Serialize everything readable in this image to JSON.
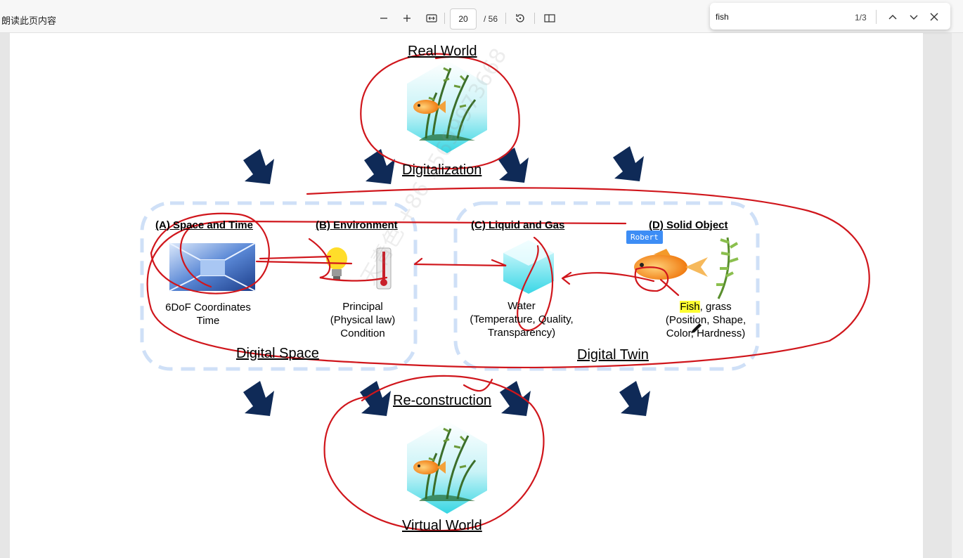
{
  "toolbar": {
    "read_aloud": "朗读此页内容",
    "current_page": "20",
    "total_pages": "/ 56",
    "zoom_out_icon": "minus-icon",
    "zoom_in_icon": "plus-icon",
    "fit_icon": "fit-width-icon",
    "rotate_icon": "rotate-icon",
    "layout_icon": "two-page-icon"
  },
  "find": {
    "query": "fish",
    "count": "1/3",
    "prev_icon": "chevron-up-icon",
    "next_icon": "chevron-down-icon",
    "close_icon": "close-icon"
  },
  "figure": {
    "real_world": "Real World",
    "digitalization": "Digitalization",
    "a_title": "(A) Space and Time",
    "a_desc1": "6DoF Coordinates",
    "a_desc2": "Time",
    "b_title": "(B) Environment",
    "b_desc1": "Principal",
    "b_desc2": "(Physical law)",
    "b_desc3": "Condition",
    "c_title": "(C) Liquid and Gas",
    "c_desc1": "Water",
    "c_desc2": "(Temperature, Quality,",
    "c_desc3": "Transparency)",
    "d_title": "(D) Solid Object",
    "d_desc_fish": "Fish",
    "d_desc_rest": ", grass",
    "d_desc2": "(Position, Shape,",
    "d_desc3": "Color, Hardness)",
    "digital_space": "Digital Space",
    "digital_twin": "Digital Twin",
    "reconstruction": "Re-construction",
    "virtual_world": "Virtual World"
  },
  "annotation": {
    "user_tag": "Robert",
    "watermark": "天青色 +86 15699973668",
    "ink_color": "#d0161c"
  },
  "colors": {
    "arrow": "#0f2a57",
    "dash": "#cfe0f7",
    "find_highlight": "#ffff33"
  }
}
